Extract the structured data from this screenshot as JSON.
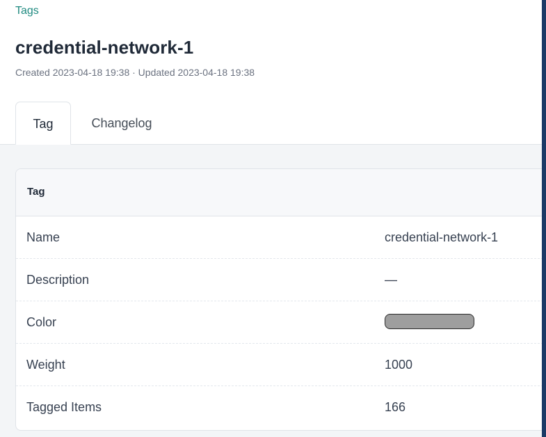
{
  "breadcrumb": {
    "label": "Tags"
  },
  "header": {
    "title": "credential-network-1",
    "meta": "Created 2023-04-18 19:38 · Updated 2023-04-18 19:38"
  },
  "tabs": [
    {
      "label": "Tag",
      "active": true
    },
    {
      "label": "Changelog",
      "active": false
    }
  ],
  "card": {
    "title": "Tag",
    "rows": [
      {
        "label": "Name",
        "value": "credential-network-1"
      },
      {
        "label": "Description",
        "value": "—"
      },
      {
        "label": "Color",
        "value": "",
        "swatch": "#9e9e9e"
      },
      {
        "label": "Weight",
        "value": "1000"
      },
      {
        "label": "Tagged Items",
        "value": "166"
      }
    ]
  },
  "colors": {
    "accent": "#1f8a80",
    "window_edge": "#1b3a66",
    "content_background": "#f3f5f7"
  }
}
